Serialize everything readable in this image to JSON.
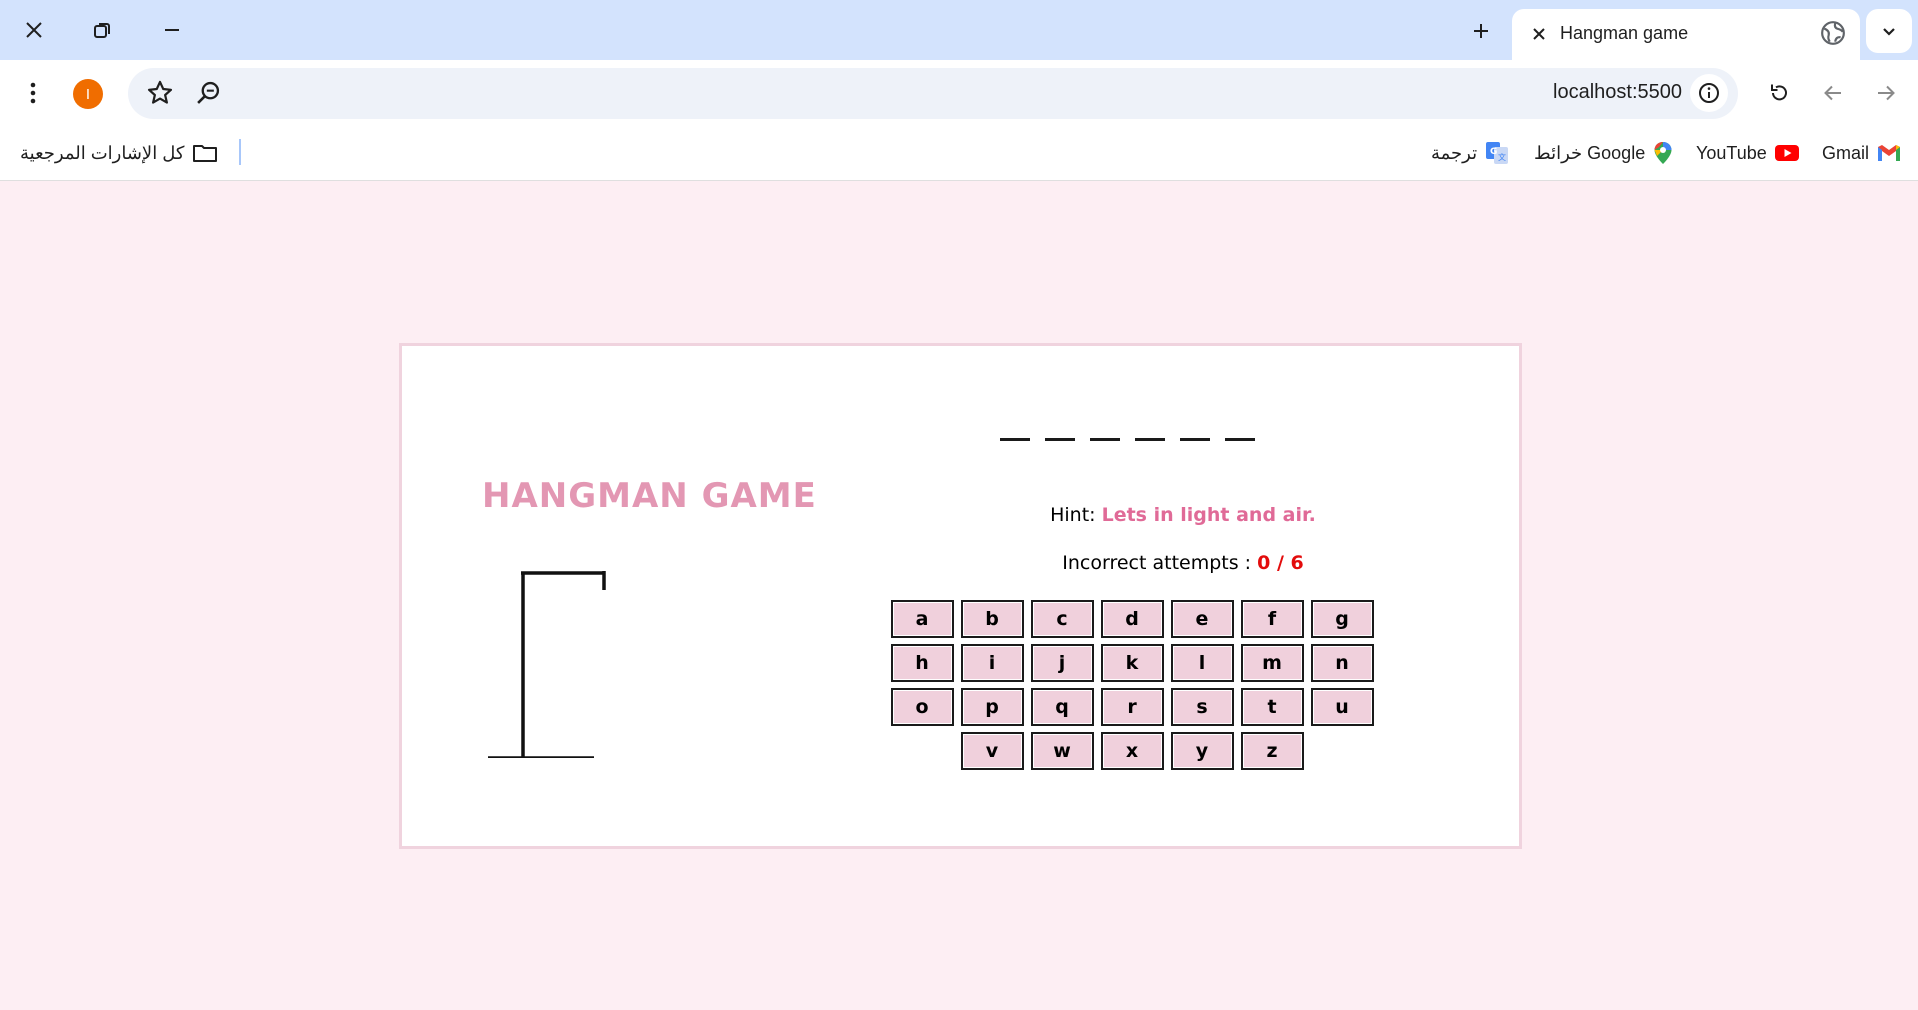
{
  "browser": {
    "tab_title": "Hangman game",
    "url": "localhost:5500",
    "profile_initial": "I",
    "bookmarks": [
      {
        "label": "Gmail",
        "icon": "gmail-icon"
      },
      {
        "label": "YouTube",
        "icon": "youtube-icon"
      },
      {
        "label": "خرائط Google",
        "icon": "google-maps-icon"
      },
      {
        "label": "ترجمة",
        "icon": "google-translate-icon"
      }
    ],
    "all_bookmarks_label": "كل الإشارات المرجعية"
  },
  "game": {
    "title": "HANGMAN GAME",
    "word_length": 6,
    "hint_label": "Hint:",
    "hint_text": "Lets in light and air.",
    "attempts_label": "Incorrect attempts :",
    "attempts_value": "0 / 6",
    "keys": [
      "a",
      "b",
      "c",
      "d",
      "e",
      "f",
      "g",
      "h",
      "i",
      "j",
      "k",
      "l",
      "m",
      "n",
      "o",
      "p",
      "q",
      "r",
      "s",
      "t",
      "u",
      "v",
      "w",
      "x",
      "y",
      "z"
    ]
  },
  "colors": {
    "page_bg": "#fdeef3",
    "title": "#e397b3",
    "hint_text": "#e06a97",
    "attempts_value": "#e30c0c",
    "key_bg": "#f0d0dc"
  }
}
